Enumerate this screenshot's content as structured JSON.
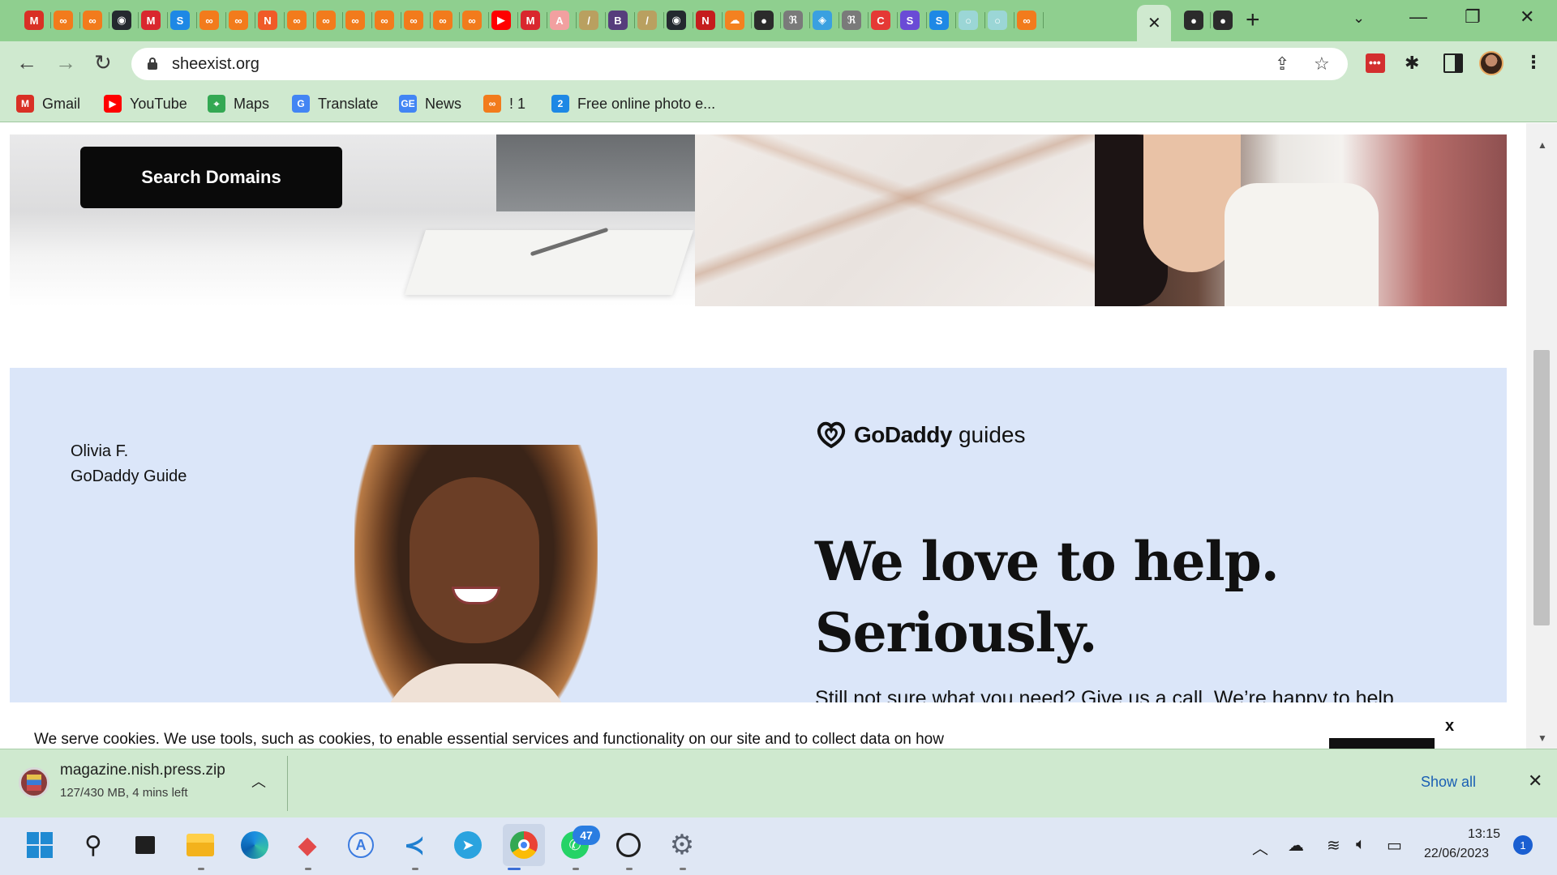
{
  "browser": {
    "url": "sheexist.org",
    "tabs": [
      {
        "icon": "gmail-icon",
        "glyph": "M",
        "color": "#d93025"
      },
      {
        "icon": "link-icon",
        "glyph": "∞",
        "color": "#f27b1c"
      },
      {
        "icon": "link-icon",
        "glyph": "∞",
        "color": "#f27b1c"
      },
      {
        "icon": "github-icon",
        "glyph": "◉",
        "color": "#24292f"
      },
      {
        "icon": "mega-icon",
        "glyph": "M",
        "color": "#d9272e"
      },
      {
        "icon": "s-icon",
        "glyph": "S",
        "color": "#1e88e5"
      },
      {
        "icon": "link-icon",
        "glyph": "∞",
        "color": "#f27b1c"
      },
      {
        "icon": "link-icon",
        "glyph": "∞",
        "color": "#f27b1c"
      },
      {
        "icon": "n-icon",
        "glyph": "N",
        "color": "#f05a28"
      },
      {
        "icon": "link-icon",
        "glyph": "∞",
        "color": "#f27b1c"
      },
      {
        "icon": "link-icon",
        "glyph": "∞",
        "color": "#f27b1c"
      },
      {
        "icon": "link-icon",
        "glyph": "∞",
        "color": "#f27b1c"
      },
      {
        "icon": "link-icon",
        "glyph": "∞",
        "color": "#f27b1c"
      },
      {
        "icon": "link-icon",
        "glyph": "∞",
        "color": "#f27b1c"
      },
      {
        "icon": "link-icon",
        "glyph": "∞",
        "color": "#f27b1c"
      },
      {
        "icon": "link-icon",
        "glyph": "∞",
        "color": "#f27b1c"
      },
      {
        "icon": "youtube-icon",
        "glyph": "▶",
        "color": "#ff0000"
      },
      {
        "icon": "mega-icon",
        "glyph": "M",
        "color": "#d9272e"
      },
      {
        "icon": "airbnb-icon",
        "glyph": "A",
        "color": "#f2a0a0"
      },
      {
        "icon": "feather-icon",
        "glyph": "/",
        "color": "#b9a060"
      },
      {
        "icon": "b-icon",
        "glyph": "B",
        "color": "#563d7c"
      },
      {
        "icon": "feather-icon",
        "glyph": "/",
        "color": "#b9a060"
      },
      {
        "icon": "github-icon",
        "glyph": "◉",
        "color": "#24292f"
      },
      {
        "icon": "n-red-icon",
        "glyph": "N",
        "color": "#c51d1d"
      },
      {
        "icon": "cloud-icon",
        "glyph": "☁",
        "color": "#f48120"
      },
      {
        "icon": "globe-icon",
        "glyph": "●",
        "color": "#2b2b2b"
      },
      {
        "icon": "seal-icon",
        "glyph": "ℜ",
        "color": "#7a7a7a"
      },
      {
        "icon": "pin-icon",
        "glyph": "◈",
        "color": "#3aa0e0"
      },
      {
        "icon": "seal-icon",
        "glyph": "ℜ",
        "color": "#7a7a7a"
      },
      {
        "icon": "c-icon",
        "glyph": "C",
        "color": "#e53935"
      },
      {
        "icon": "s-purple-icon",
        "glyph": "S",
        "color": "#6a4bd6"
      },
      {
        "icon": "s-icon",
        "glyph": "S",
        "color": "#1e88e5"
      },
      {
        "icon": "ring-icon",
        "glyph": "○",
        "color": "#9bd6d6"
      },
      {
        "icon": "ring-icon",
        "glyph": "○",
        "color": "#9bd6d6"
      },
      {
        "icon": "link-icon",
        "glyph": "∞",
        "color": "#f27b1c"
      },
      {
        "icon": "active-tab",
        "glyph": "",
        "color": ""
      },
      {
        "icon": "globe-icon",
        "glyph": "●",
        "color": "#2b2b2b"
      },
      {
        "icon": "globe-icon",
        "glyph": "●",
        "color": "#2b2b2b"
      }
    ],
    "bookmarks": [
      {
        "label": "Gmail",
        "icon": "gmail-icon",
        "glyph": "M",
        "color": "#d93025"
      },
      {
        "label": "YouTube",
        "icon": "youtube-icon",
        "glyph": "▶",
        "color": "#ff0000"
      },
      {
        "label": "Maps",
        "icon": "maps-icon",
        "glyph": "⌖",
        "color": "#34a853"
      },
      {
        "label": "Translate",
        "icon": "translate-icon",
        "glyph": "G",
        "color": "#4285f4"
      },
      {
        "label": "News",
        "icon": "news-icon",
        "glyph": "GE",
        "color": "#4285f4"
      },
      {
        "label": "! 1",
        "icon": "link-icon",
        "glyph": "∞",
        "color": "#f27b1c"
      },
      {
        "label": "Free online photo e...",
        "icon": "photo-editor-icon",
        "glyph": "2",
        "color": "#1e88e5"
      }
    ]
  },
  "page": {
    "search_button": "Search Domains",
    "guide": {
      "name": "Olivia F.",
      "role": "GoDaddy Guide",
      "logo_brand": "GoDaddy",
      "logo_suffix": "guides",
      "headline_line1": "We love to help.",
      "headline_line2": "Seriously.",
      "subtext": "Still not sure what you need? Give us a call. We’re happy to help."
    },
    "cookie": {
      "text": "We serve cookies. We use tools, such as cookies, to enable essential services and functionality on our site and to collect data on how",
      "close": "x"
    }
  },
  "download": {
    "filename": "magazine.nish.press.zip",
    "status": "127/430 MB, 4 mins left",
    "show_all": "Show all"
  },
  "taskbar": {
    "whatsapp_badge": "47",
    "time": "13:15",
    "date": "22/06/2023",
    "notifications": "1"
  },
  "colors": {
    "tab_strip": "#8fcf8f",
    "toolbar": "#cfe9cf",
    "guides_bg": "#dbe6f9",
    "button_black": "#0a0a0a",
    "link_blue": "#1a5fb4"
  }
}
